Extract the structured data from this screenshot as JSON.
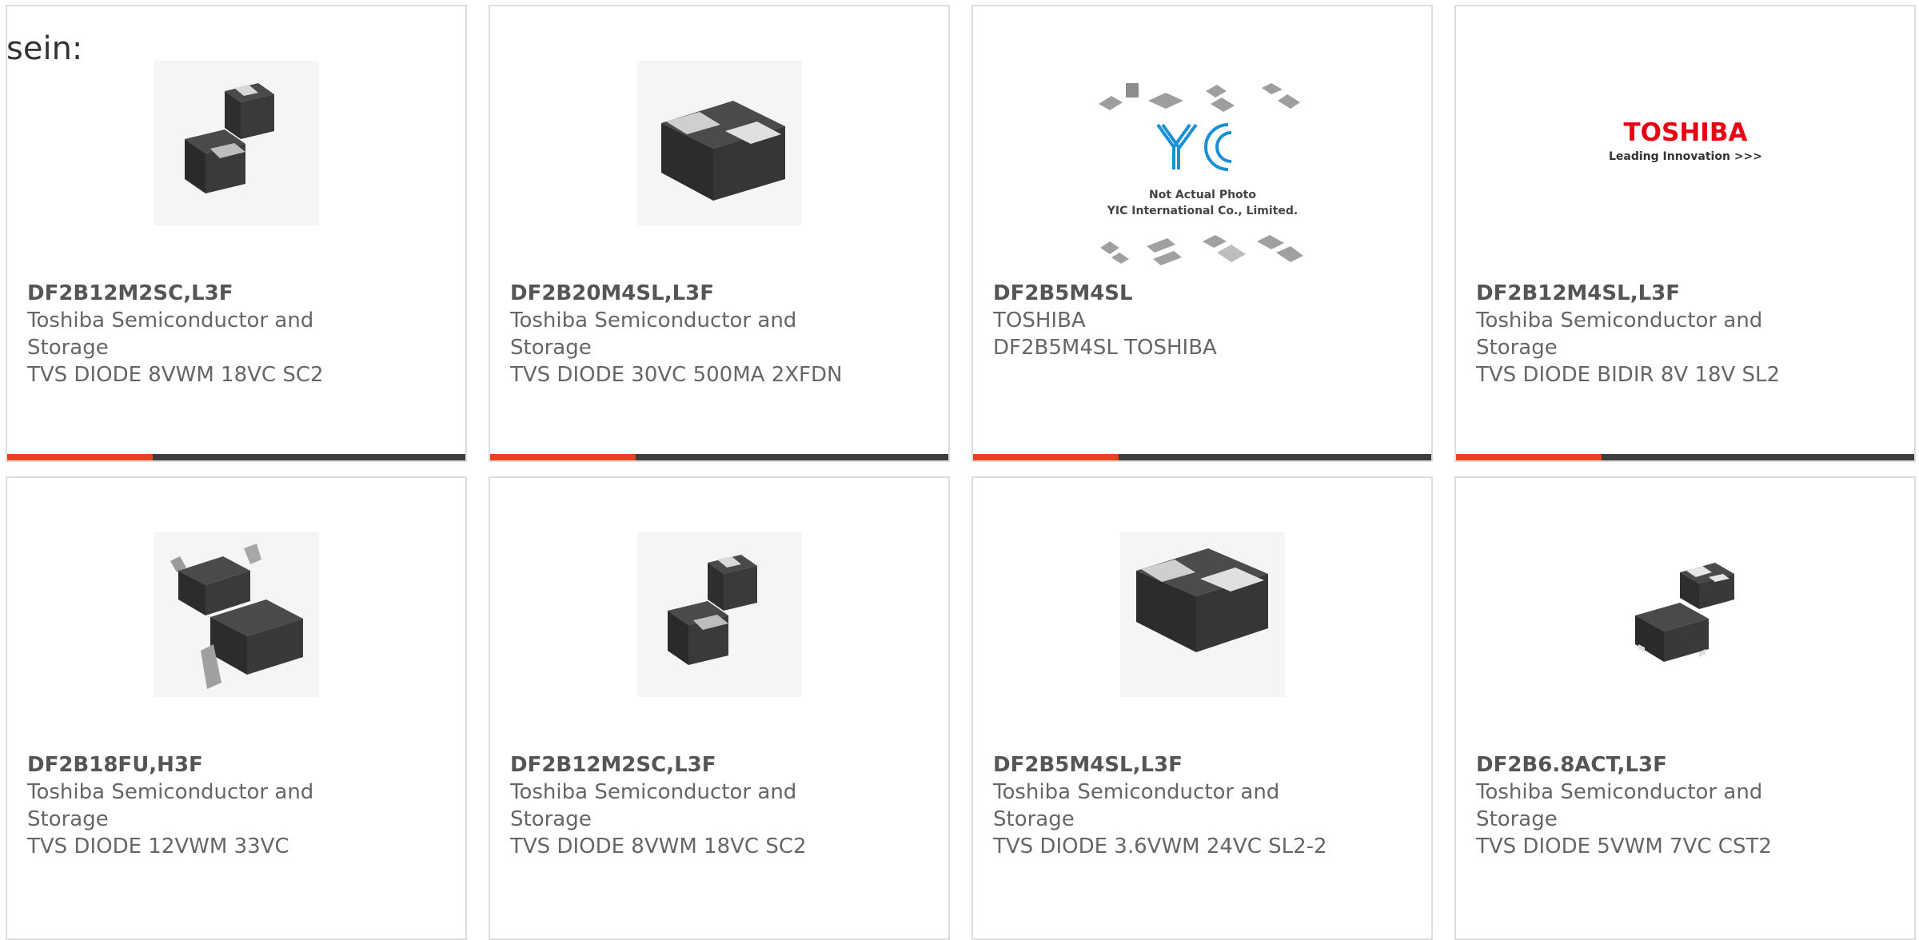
{
  "lead_text": "sein:",
  "products": [
    {
      "part": "DF2B12M2SC,L3F",
      "manufacturer": "Toshiba Semiconductor and Storage",
      "description": "TVS DIODE 8VWM 18VC SC2",
      "image": "two-chip-package"
    },
    {
      "part": "DF2B20M4SL,L3F",
      "manufacturer": "Toshiba Semiconductor and Storage",
      "description": "TVS DIODE 30VC 500MA 2XFDN",
      "image": "single-chip-package"
    },
    {
      "part": "DF2B5M4SL",
      "manufacturer": "TOSHIBA",
      "description": "DF2B5M4SL TOSHIBA",
      "image": "yic-not-actual-photo",
      "image_text": {
        "logo": "YIC",
        "line1": "Not Actual Photo",
        "line2": "YIC International Co., Limited."
      }
    },
    {
      "part": "DF2B12M4SL,L3F",
      "manufacturer": "Toshiba Semiconductor and Storage",
      "description": "TVS DIODE BIDIR 8V 18V SL2",
      "image": "toshiba-logo",
      "image_text": {
        "logo": "TOSHIBA",
        "tagline": "Leading Innovation >>>"
      }
    },
    {
      "part": "DF2B18FU,H3F",
      "manufacturer": "Toshiba Semiconductor and Storage",
      "description": "TVS DIODE 12VWM 33VC",
      "image": "leaded-package"
    },
    {
      "part": "DF2B12M2SC,L3F",
      "manufacturer": "Toshiba Semiconductor and Storage",
      "description": "TVS DIODE 8VWM 18VC SC2",
      "image": "two-chip-package"
    },
    {
      "part": "DF2B5M4SL,L3F",
      "manufacturer": "Toshiba Semiconductor and Storage",
      "description": "TVS DIODE 3.6VWM 24VC SL2-2",
      "image": "single-chip-package"
    },
    {
      "part": "DF2B6.8ACT,L3F",
      "manufacturer": "Toshiba Semiconductor and Storage",
      "description": "TVS DIODE 5VWM 7VC CST2",
      "image": "two-chip-package-cst"
    }
  ],
  "colors": {
    "accent": "#e8431c",
    "bar": "#3d3d3d",
    "border": "#dddddd",
    "toshiba_red": "#e60012",
    "yic_blue": "#1b8fd6"
  }
}
